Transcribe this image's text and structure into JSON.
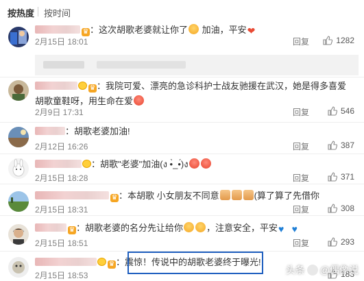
{
  "sort": {
    "hot": "按热度",
    "time": "按时间"
  },
  "labels": {
    "reply": "回复"
  },
  "comments": [
    {
      "text": "这次胡歌老婆就让你了",
      "text2": "加油，平安",
      "time": "2月15日 18:01",
      "likes": "1282"
    },
    {
      "text": "我院可爱、漂亮的急诊科护士战友驰援在武汉，她是得多喜爱胡歌童鞋呀，用生命在爱",
      "time": "2月9日 17:31",
      "likes": "546"
    },
    {
      "text": "胡歌老婆加油!",
      "time": "2月12日 16:26",
      "likes": "387"
    },
    {
      "text": "胡歌\"老婆\"加油(ง •̀_•́)ง",
      "time": "2月15日 18:28",
      "likes": "371"
    },
    {
      "text": "本胡歌 小女朋友不同意",
      "text2": "(算了算了先借你",
      "time": "2月15日 18:31",
      "likes": "308"
    },
    {
      "text": "胡歌老婆的名分先让给你",
      "text2": "，注意安全，平安",
      "time": "2月15日 18:51",
      "likes": "293"
    },
    {
      "text": "震惊！传说中的胡歌老婆终于曝光!",
      "time": "2月15日 18:53",
      "likes": "183"
    }
  ],
  "watermark": {
    "left": "头条",
    "right": "@偶像说"
  },
  "icons": [
    "thumbs-up-icon",
    "vip-crown-icon",
    "emoji-icon",
    "heart-icon",
    "blue-heart-icon"
  ],
  "colors": {
    "highlight_border": "#1f5fbf",
    "heart": "#e94b35",
    "blue_heart": "#1f7fd6"
  }
}
